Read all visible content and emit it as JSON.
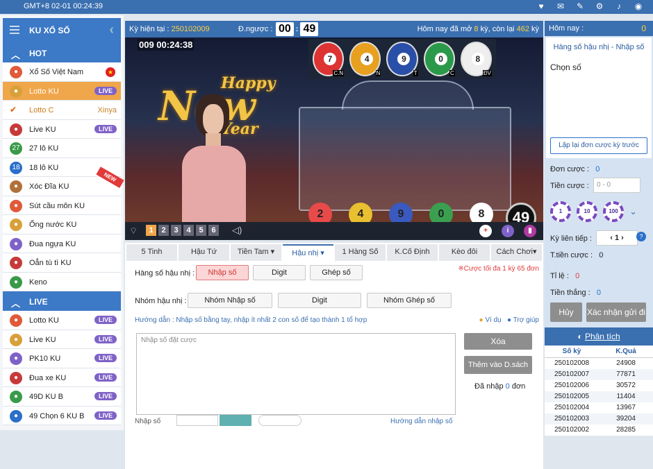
{
  "topbar": {
    "clock": "GMT+8 02-01 00:24:39"
  },
  "sidebar": {
    "title": "KU XỔ SỐ",
    "hot_label": "HOT",
    "hot_items": [
      {
        "label": "Xổ Số Việt Nam",
        "icon": "vn-lottery-icon"
      },
      {
        "label": "Lotto KU",
        "badge": "LIVE",
        "active": true
      },
      {
        "label": "Lotto C",
        "extra": "Xinya",
        "sub": true
      },
      {
        "label": "Live KU",
        "badge": "LIVE"
      },
      {
        "label": "27 lô KU",
        "icon_text": "27"
      },
      {
        "label": "18 lô KU",
        "icon_text": "18"
      },
      {
        "label": "Xóc Đĩa KU",
        "new_tag": "NEW"
      },
      {
        "label": "Sút cầu môn KU"
      },
      {
        "label": "Ống nước KU"
      },
      {
        "label": "Đua ngựa KU"
      },
      {
        "label": "Oẳn tù tì KU"
      },
      {
        "label": "Keno"
      }
    ],
    "live_label": "LIVE",
    "live_items": [
      {
        "label": "Lotto KU",
        "badge": "LIVE"
      },
      {
        "label": "Live KU",
        "badge": "LIVE"
      },
      {
        "label": "PK10 KU",
        "badge": "LIVE"
      },
      {
        "label": "Đua xe KU",
        "badge": "LIVE"
      },
      {
        "label": "49D KU B",
        "badge": "LIVE"
      },
      {
        "label": "49 Chọn 6 KU B",
        "badge": "LIVE"
      }
    ]
  },
  "info": {
    "ky_label": "Kỳ hiện tại :",
    "ky_value": "250102009",
    "countdown_label": "Đ.ngược :",
    "cd_min": "00",
    "cd_sec": "49",
    "today_prefix": "Hôm nay đã mở",
    "opened": "8",
    "mid": "kỳ, còn lại",
    "remaining": "462",
    "suffix": "kỳ"
  },
  "video": {
    "stamp": "009 00:24:38",
    "banner_top": "Happy",
    "banner_mid": "New",
    "banner_bot": "Year",
    "result_balls": [
      {
        "num": "7",
        "tag": "C.N",
        "color": "#d33"
      },
      {
        "num": "4",
        "tag": "N",
        "color": "#e8a020"
      },
      {
        "num": "9",
        "tag": "T",
        "color": "#2a4fa8"
      },
      {
        "num": "0",
        "tag": "C",
        "color": "#2a9a4a"
      },
      {
        "num": "8",
        "tag": "ĐV",
        "color": "#eeeeee"
      }
    ],
    "tubes": [
      {
        "num": "2",
        "color": "#e84a4a"
      },
      {
        "num": "4",
        "color": "#e8c030"
      },
      {
        "num": "9",
        "color": "#3a5ac0"
      },
      {
        "num": "0",
        "color": "#3aa050"
      },
      {
        "num": "8",
        "color": "#ffffff"
      }
    ],
    "big_number": "49",
    "cam_numbers": [
      "1",
      "2",
      "3",
      "4",
      "5",
      "6"
    ]
  },
  "tabs": [
    "5 Tinh",
    "Hậu Tứ",
    "Tiền Tam ▾",
    "Hậu nhị ▾",
    "1 Hàng Số",
    "K.Cố Định",
    "Kèo đôi",
    "Cách Chơi▾"
  ],
  "active_tab": 3,
  "panel": {
    "hang_label": "Hàng số hậu nhị :",
    "hang_btns": [
      "Nhập số",
      "Digit",
      "Ghép số"
    ],
    "warn": "※Cược tối đa 1 kỳ 65 đơn",
    "nhom_label": "Nhóm hậu nhị :",
    "nhom_btns": [
      "Nhóm Nhập số",
      "Digit",
      "Nhóm Ghép số"
    ],
    "guide": "Hướng dẫn : Nhập số bằng tay, nhập ít nhất 2 con số để tạo thành 1 tổ hợp",
    "example": "Ví dụ",
    "help": "Trợ giúp",
    "placeholder": "Nhập số đặt cược",
    "delete": "Xóa",
    "add": "Thêm vào D.sách",
    "entered_prefix": "Đã nhập",
    "entered_count": "0",
    "entered_suffix": "đơn",
    "bottom_label": "Nhập số",
    "bottom_link": "Hướng dẫn nhập số"
  },
  "right": {
    "today_label": "Hôm nay :",
    "today_value": "0",
    "title": "Hàng số hậu nhị - Nhập số",
    "choose": "Chọn số",
    "repeat": "Lập lại đơn cược kỳ trước",
    "don_label": "Đơn cược :",
    "don_value": "0",
    "tien_label": "Tiền cược :",
    "tien_placeholder": "0 - 0",
    "chips": [
      "1",
      "10",
      "100"
    ],
    "ky_lien_label": "Kỳ liên tiếp :",
    "ky_lien_value": "1",
    "ttien_label": "T.tiền cược :",
    "ttien_value": "0",
    "tile_label": "Tỉ lệ :",
    "tile_value": "0",
    "thang_label": "Tiền thắng :",
    "thang_value": "0",
    "cancel": "Hủy",
    "confirm": "Xác nhận gửi đi",
    "analysis": "Phân tích",
    "table_head": [
      "Số kỳ",
      "K.Quả"
    ],
    "results": [
      [
        "250102008",
        "24908"
      ],
      [
        "250102007",
        "77871"
      ],
      [
        "250102006",
        "30572"
      ],
      [
        "250102005",
        "11404"
      ],
      [
        "250102004",
        "13967"
      ],
      [
        "250102003",
        "39204"
      ],
      [
        "250102002",
        "28285"
      ]
    ]
  }
}
